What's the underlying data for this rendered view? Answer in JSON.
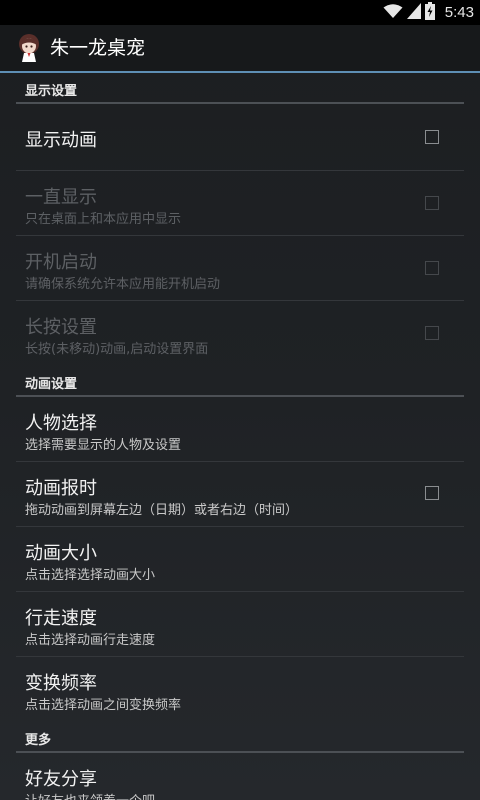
{
  "status_bar": {
    "time": "5:43",
    "icons": [
      "wifi-icon",
      "signal-icon",
      "battery-charging-icon"
    ]
  },
  "action_bar": {
    "title": "朱一龙桌宠",
    "icon": "app-character-icon"
  },
  "sections": [
    {
      "header": "显示设置",
      "items": [
        {
          "title": "显示动画",
          "summary": "",
          "checkbox": true,
          "checked": false,
          "enabled": true
        },
        {
          "title": "一直显示",
          "summary": "只在桌面上和本应用中显示",
          "checkbox": true,
          "checked": false,
          "enabled": false
        },
        {
          "title": "开机启动",
          "summary": "请确保系统允许本应用能开机启动",
          "checkbox": true,
          "checked": false,
          "enabled": false
        },
        {
          "title": "长按设置",
          "summary": "长按(未移动)动画,启动设置界面",
          "checkbox": true,
          "checked": false,
          "enabled": false
        }
      ]
    },
    {
      "header": "动画设置",
      "items": [
        {
          "title": "人物选择",
          "summary": "选择需要显示的人物及设置",
          "checkbox": false,
          "enabled": true
        },
        {
          "title": "动画报时",
          "summary": "拖动动画到屏幕左边（日期）或者右边（时间）",
          "checkbox": true,
          "checked": false,
          "enabled": true
        },
        {
          "title": "动画大小",
          "summary": "点击选择选择动画大小",
          "checkbox": false,
          "enabled": true
        },
        {
          "title": "行走速度",
          "summary": "点击选择动画行走速度",
          "checkbox": false,
          "enabled": true
        },
        {
          "title": "变换频率",
          "summary": "点击选择动画之间变换频率",
          "checkbox": false,
          "enabled": true
        }
      ]
    },
    {
      "header": "更多",
      "items": [
        {
          "title": "好友分享",
          "summary": "让好友也来领养一个吧",
          "checkbox": false,
          "enabled": true
        }
      ]
    }
  ]
}
